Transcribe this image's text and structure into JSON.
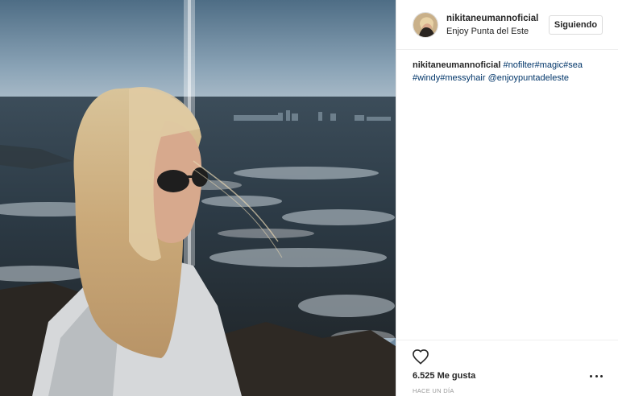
{
  "post": {
    "username": "nikitaneumannoficial",
    "location": "Enjoy Punta del Este",
    "follow_label": "Siguiendo",
    "caption": {
      "user": "nikitaneumannoficial",
      "tags_line1": [
        "#nofilter",
        "#magic",
        "#sea"
      ],
      "tags_line2": [
        "#windy",
        "#messyhair"
      ],
      "mention": "@enjoypuntadeleste"
    },
    "likes": "6.525 Me gusta",
    "timestamp": "HACE UN DÍA"
  },
  "icons": {
    "like": "heart-icon",
    "more": "more-options-icon",
    "avatar": "avatar"
  },
  "colors": {
    "link": "#003569",
    "border": "#dbdbdb",
    "text": "#262626",
    "muted": "#999999"
  }
}
